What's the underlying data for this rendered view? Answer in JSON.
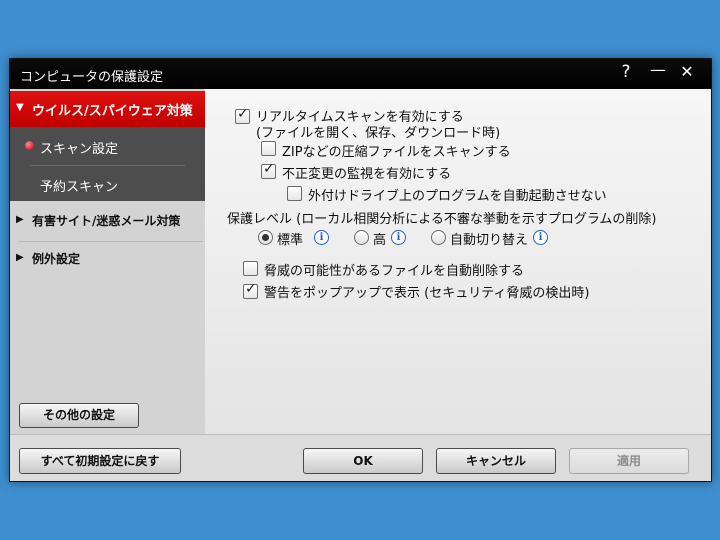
{
  "window": {
    "title": "コンピュータの保護設定",
    "help_label": "?",
    "minimize_label": "—",
    "close_label": "✕"
  },
  "sidebar": {
    "active_section": "ウイルス/スパイウェア対策",
    "items": [
      {
        "label": "スキャン設定",
        "active": true
      },
      {
        "label": "予約スキャン",
        "active": false
      }
    ],
    "sections": [
      {
        "label": "有害サイト/迷惑メール対策"
      },
      {
        "label": "例外設定"
      }
    ],
    "other_settings_label": "その他の設定"
  },
  "main": {
    "realtime_scan": {
      "label": "リアルタイムスキャンを有効にする",
      "sublabel": "(ファイルを開く、保存、ダウンロード時)",
      "checked": true
    },
    "zip_scan": {
      "label": "ZIPなどの圧縮ファイルをスキャンする",
      "checked": false
    },
    "tamper_watch": {
      "label": "不正変更の監視を有効にする",
      "checked": true
    },
    "external_drive": {
      "label": "外付けドライブ上のプログラムを自動起動させない",
      "checked": false
    },
    "protection_level": {
      "label": "保護レベル (ローカル相関分析による不審な挙動を示すプログラムの削除)",
      "options": [
        {
          "label": "標準",
          "selected": true
        },
        {
          "label": "高",
          "selected": false
        },
        {
          "label": "自動切り替え",
          "selected": false
        }
      ]
    },
    "auto_delete": {
      "label": "脅威の可能性があるファイルを自動削除する",
      "checked": false
    },
    "popup_warning": {
      "label": "警告をポップアップで表示 (セキュリティ脅威の検出時)",
      "checked": true
    }
  },
  "footer": {
    "reset_label": "すべて初期設定に戻す",
    "ok_label": "OK",
    "cancel_label": "キャンセル",
    "apply_label": "適用"
  },
  "colors": {
    "accent": "#d40000",
    "background": "#3e8fd0",
    "titlebar": "#000000",
    "info_icon": "#1e63c8"
  }
}
